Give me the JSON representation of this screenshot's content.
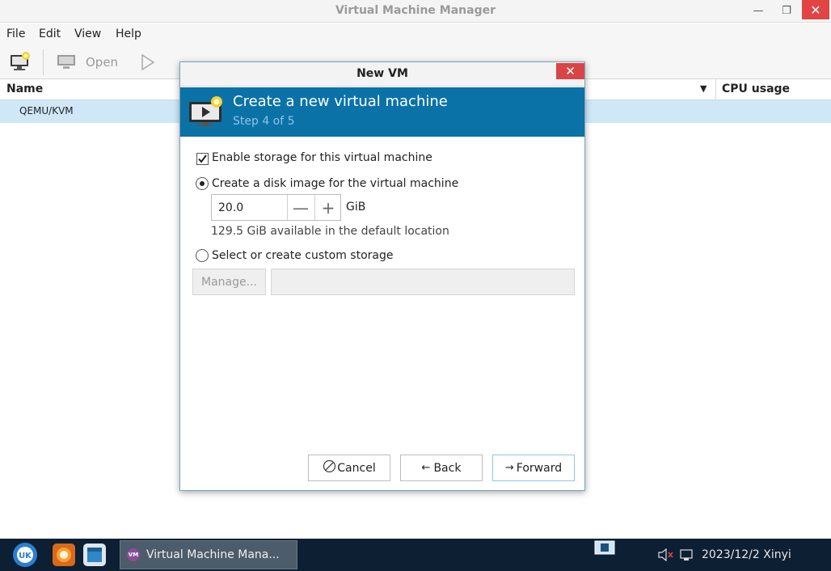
{
  "window": {
    "title": "Virtual Machine Manager",
    "close_glyph": "✕",
    "min_glyph": "—",
    "max_glyph": "❐"
  },
  "menu": [
    "File",
    "Edit",
    "View",
    "Help"
  ],
  "toolbar": {
    "open_label": "Open"
  },
  "list": {
    "columns": [
      "Name",
      "CPU usage"
    ],
    "rows": [
      "QEMU/KVM"
    ]
  },
  "dialog": {
    "title": "New VM",
    "close_glyph": "✕",
    "header_title": "Create a new virtual machine",
    "header_step": "Step 4 of 5",
    "enable_storage_label": "Enable storage for this virtual machine",
    "enable_storage_checked": true,
    "create_disk_label": "Create a disk image for the virtual machine",
    "disk_size_value": "20.0",
    "disk_unit": "GiB",
    "available_text": "129.5 GiB available in the default location",
    "custom_storage_label": "Select or create custom storage",
    "manage_label": "Manage...",
    "cancel_label": "Cancel",
    "back_label": "Back",
    "forward_label": "Forward",
    "minus_glyph": "—",
    "plus_glyph": "+"
  },
  "taskbar": {
    "task_label": "Virtual Machine Mana...",
    "task_icon_text": "VM",
    "tray_text": "2023/12/2 Xinyi"
  },
  "colors": {
    "header_blue": "#0b72a8",
    "selection": "#cfe8f8",
    "close_red": "#d94545",
    "taskbar": "#0d1f33"
  }
}
